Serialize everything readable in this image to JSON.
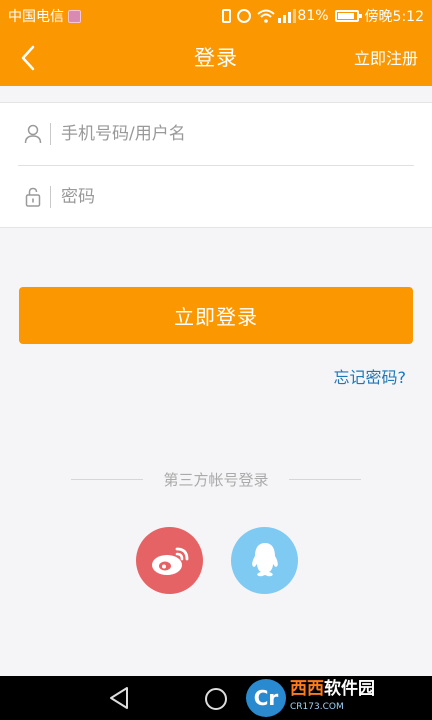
{
  "status_bar": {
    "carrier": "中国电信",
    "battery_percent": "81%",
    "time": "傍晚5:12"
  },
  "header": {
    "title": "登录",
    "register_label": "立即注册"
  },
  "form": {
    "username_placeholder": "手机号码/用户名",
    "password_placeholder": "密码"
  },
  "login_label": "立即登录",
  "forgot_label": "忘记密码?",
  "third_party_label": "第三方帐号登录",
  "watermark": {
    "logo_text": "Cr",
    "name_orange": "西西",
    "name_white": "软件园",
    "sub": "CR173.COM"
  },
  "colors": {
    "brand": "#fb9700",
    "link": "#1d78b8",
    "weibo": "#e66365",
    "qq": "#7fcaf2"
  }
}
